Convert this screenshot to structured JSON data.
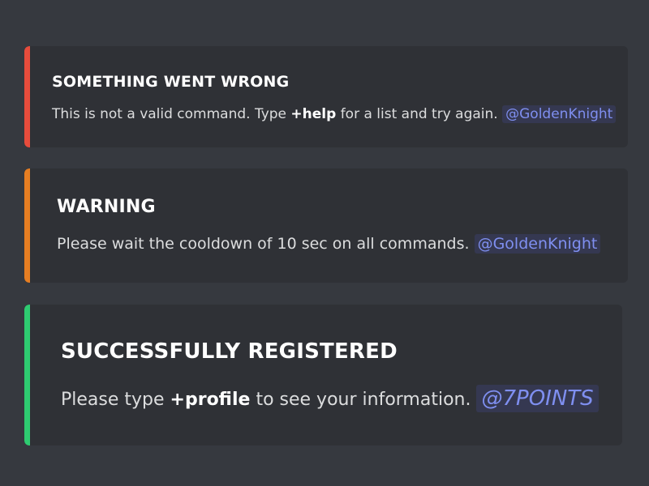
{
  "embeds": [
    {
      "color": "#e74c3c",
      "title": "SOMETHING WENT WRONG",
      "desc_before": "This is not a valid command. Type ",
      "desc_bold": "+help",
      "desc_after": " for a list and try again. ",
      "mention": "@GoldenKnight"
    },
    {
      "color": "#e67e22",
      "title": "WARNING",
      "desc_before": "Please wait the cooldown of 10 sec on all commands. ",
      "mention": "@GoldenKnight"
    },
    {
      "color": "#2ecc71",
      "title": "SUCCESSFULLY REGISTERED",
      "desc_before": "Please type ",
      "desc_bold": "+profile",
      "desc_after": " to see your information. ",
      "mention": "@7POINTS"
    }
  ]
}
